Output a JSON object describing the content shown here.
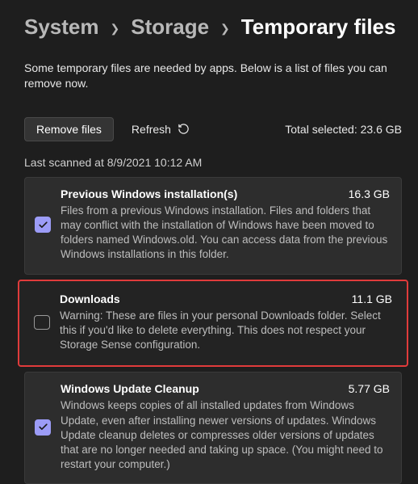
{
  "breadcrumb": {
    "items": [
      "System",
      "Storage",
      "Temporary files"
    ]
  },
  "description": "Some temporary files are needed by apps. Below is a list of files you can remove now.",
  "actions": {
    "remove_label": "Remove files",
    "refresh_label": "Refresh",
    "total_prefix": "Total selected: ",
    "total_value": "23.6 GB"
  },
  "last_scanned": "Last scanned at 8/9/2021 10:12 AM",
  "items": [
    {
      "title": "Previous Windows installation(s)",
      "size": "16.3 GB",
      "desc": "Files from a previous Windows installation.  Files and folders that may conflict with the installation of Windows have been moved to folders named Windows.old.  You can access data from the previous Windows installations in this folder.",
      "checked": true,
      "highlighted": false
    },
    {
      "title": "Downloads",
      "size": "11.1 GB",
      "desc": "Warning: These are files in your personal Downloads folder. Select this if you'd like to delete everything. This does not respect your Storage Sense configuration.",
      "checked": false,
      "highlighted": true
    },
    {
      "title": "Windows Update Cleanup",
      "size": "5.77 GB",
      "desc": "Windows keeps copies of all installed updates from Windows Update, even after installing newer versions of updates. Windows Update cleanup deletes or compresses older versions of updates that are no longer needed and taking up space. (You might need to restart your computer.)",
      "checked": true,
      "highlighted": false
    }
  ]
}
